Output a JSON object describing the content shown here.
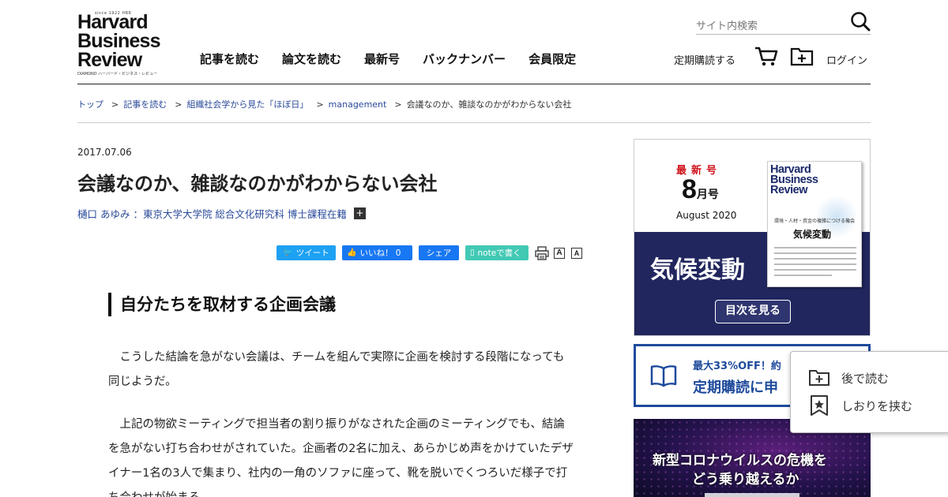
{
  "header": {
    "logo": {
      "tagline": "since 1922 HBR",
      "line1": "Harvard",
      "line2": "Business",
      "line3": "Review",
      "sub": "DIAMOND ハーバード・ビジネス・レビュー"
    },
    "nav": [
      "記事を読む",
      "論文を読む",
      "最新号",
      "バックナンバー",
      "会員限定"
    ],
    "search_placeholder": "サイト内検索",
    "subscribe_label": "定期購読する",
    "login_label": "ログイン"
  },
  "breadcrumb": [
    {
      "label": "トップ",
      "link": true
    },
    {
      "label": "記事を読む",
      "link": true
    },
    {
      "label": "組織社会学から見た「ほぼ日」",
      "link": true
    },
    {
      "label": "management",
      "link": true
    },
    {
      "label": "会議なのか、雑談なのかがわからない会社",
      "link": false
    }
  ],
  "article": {
    "date": "2017.07.06",
    "title": "会議なのか、雑談なのかがわからない会社",
    "author": "樋口 あゆみ ：東京大学大学院 総合文化研究科 博士課程在籍",
    "author_toggle": "+",
    "share": {
      "tweet": "ツイート",
      "like": "いいね！ 0",
      "share": "シェア",
      "note": "noteで書く",
      "font_large": "A",
      "font_small": "A"
    },
    "section_heading": "自分たちを取材する企画会議",
    "paragraphs": [
      "　こうした結論を急がない会議は、チームを組んで実際に企画を検討する段階になっても同じようだ。",
      "　上記の物欲ミーティングで担当者の割り振りがなされた企画のミーティングでも、結論を急がない打ち合わせがされていた。企画者の2名に加え、あらかじめ声をかけていたデザイナー1名の3人で集まり、社内の一角のソファに座って、靴を脱いでくつろいだ様子で打ち合わせが始まる。"
    ]
  },
  "sidebar": {
    "latest_issue": {
      "label": "最新号",
      "month_num": "8",
      "month_suffix": "月号",
      "date": "August 2020",
      "headline": "気候変動",
      "toc_button": "目次を見る",
      "cover": {
        "title1": "Harvard",
        "title2": "Business",
        "title3": "Review",
        "sub": "環境・人材・資金の複雑につける機会",
        "main": "気候変動"
      }
    },
    "subscription": {
      "line1": "最大33%OFF！約",
      "line2": "定期購読に申"
    },
    "corona": {
      "line1": "新型コロナウイルスの危機を",
      "line2": "どう乗り越えるか"
    }
  },
  "popup": {
    "read_later": "後で読む",
    "bookmark": "しおりを挟む"
  },
  "colors": {
    "link": "#2a4a9a",
    "twitter": "#1da1f2",
    "facebook": "#1877f2",
    "note": "#41c9b4",
    "navy": "#21265e",
    "red": "#d0121b"
  }
}
